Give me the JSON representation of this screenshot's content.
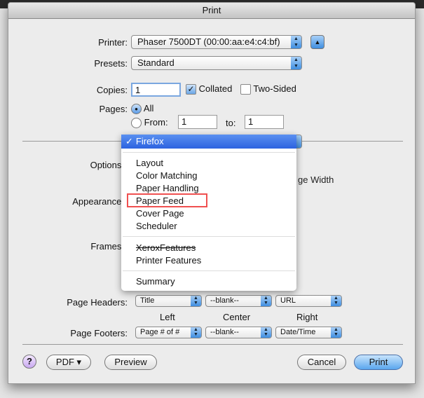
{
  "window": {
    "title": "Print"
  },
  "printer": {
    "label": "Printer:",
    "value": "Phaser 7500DT (00:00:aa:e4:c4:bf)"
  },
  "presets": {
    "label": "Presets:",
    "value": "Standard"
  },
  "copies": {
    "label": "Copies:",
    "value": "1",
    "collated": "Collated",
    "collated_checked": true,
    "two_sided": "Two-Sided",
    "two_sided_checked": false
  },
  "pages": {
    "label": "Pages:",
    "all": "All",
    "from": "From:",
    "from_value": "1",
    "to": "to:",
    "to_value": "1",
    "selected": "All"
  },
  "options": {
    "options_label": "Options:",
    "appearance_label": "Appearance:",
    "frames_label": "Frames:",
    "visible_text": "ge Width"
  },
  "menu": {
    "selected": "Firefox",
    "groups": [
      [
        "Layout",
        "Color Matching",
        "Paper Handling",
        "Paper Feed",
        "Cover Page",
        "Scheduler"
      ],
      [
        "XeroxFeatures",
        "Printer Features"
      ],
      [
        "Summary"
      ]
    ],
    "highlighted": "Paper Feed",
    "disabled": "XeroxFeatures"
  },
  "headers": {
    "label": "Page Headers:",
    "left": "Title",
    "center": "--blank--",
    "right": "URL"
  },
  "columns": {
    "left": "Left",
    "center": "Center",
    "right": "Right"
  },
  "footers": {
    "label": "Page Footers:",
    "left": "Page # of #",
    "center": "--blank--",
    "right": "Date/Time"
  },
  "buttons": {
    "help": "?",
    "pdf": "PDF ▾",
    "preview": "Preview",
    "cancel": "Cancel",
    "print": "Print"
  },
  "colors": {
    "accent": "#3f8ee0",
    "highlight_box": "#f05050",
    "menu_selection": "#3a72e8"
  }
}
